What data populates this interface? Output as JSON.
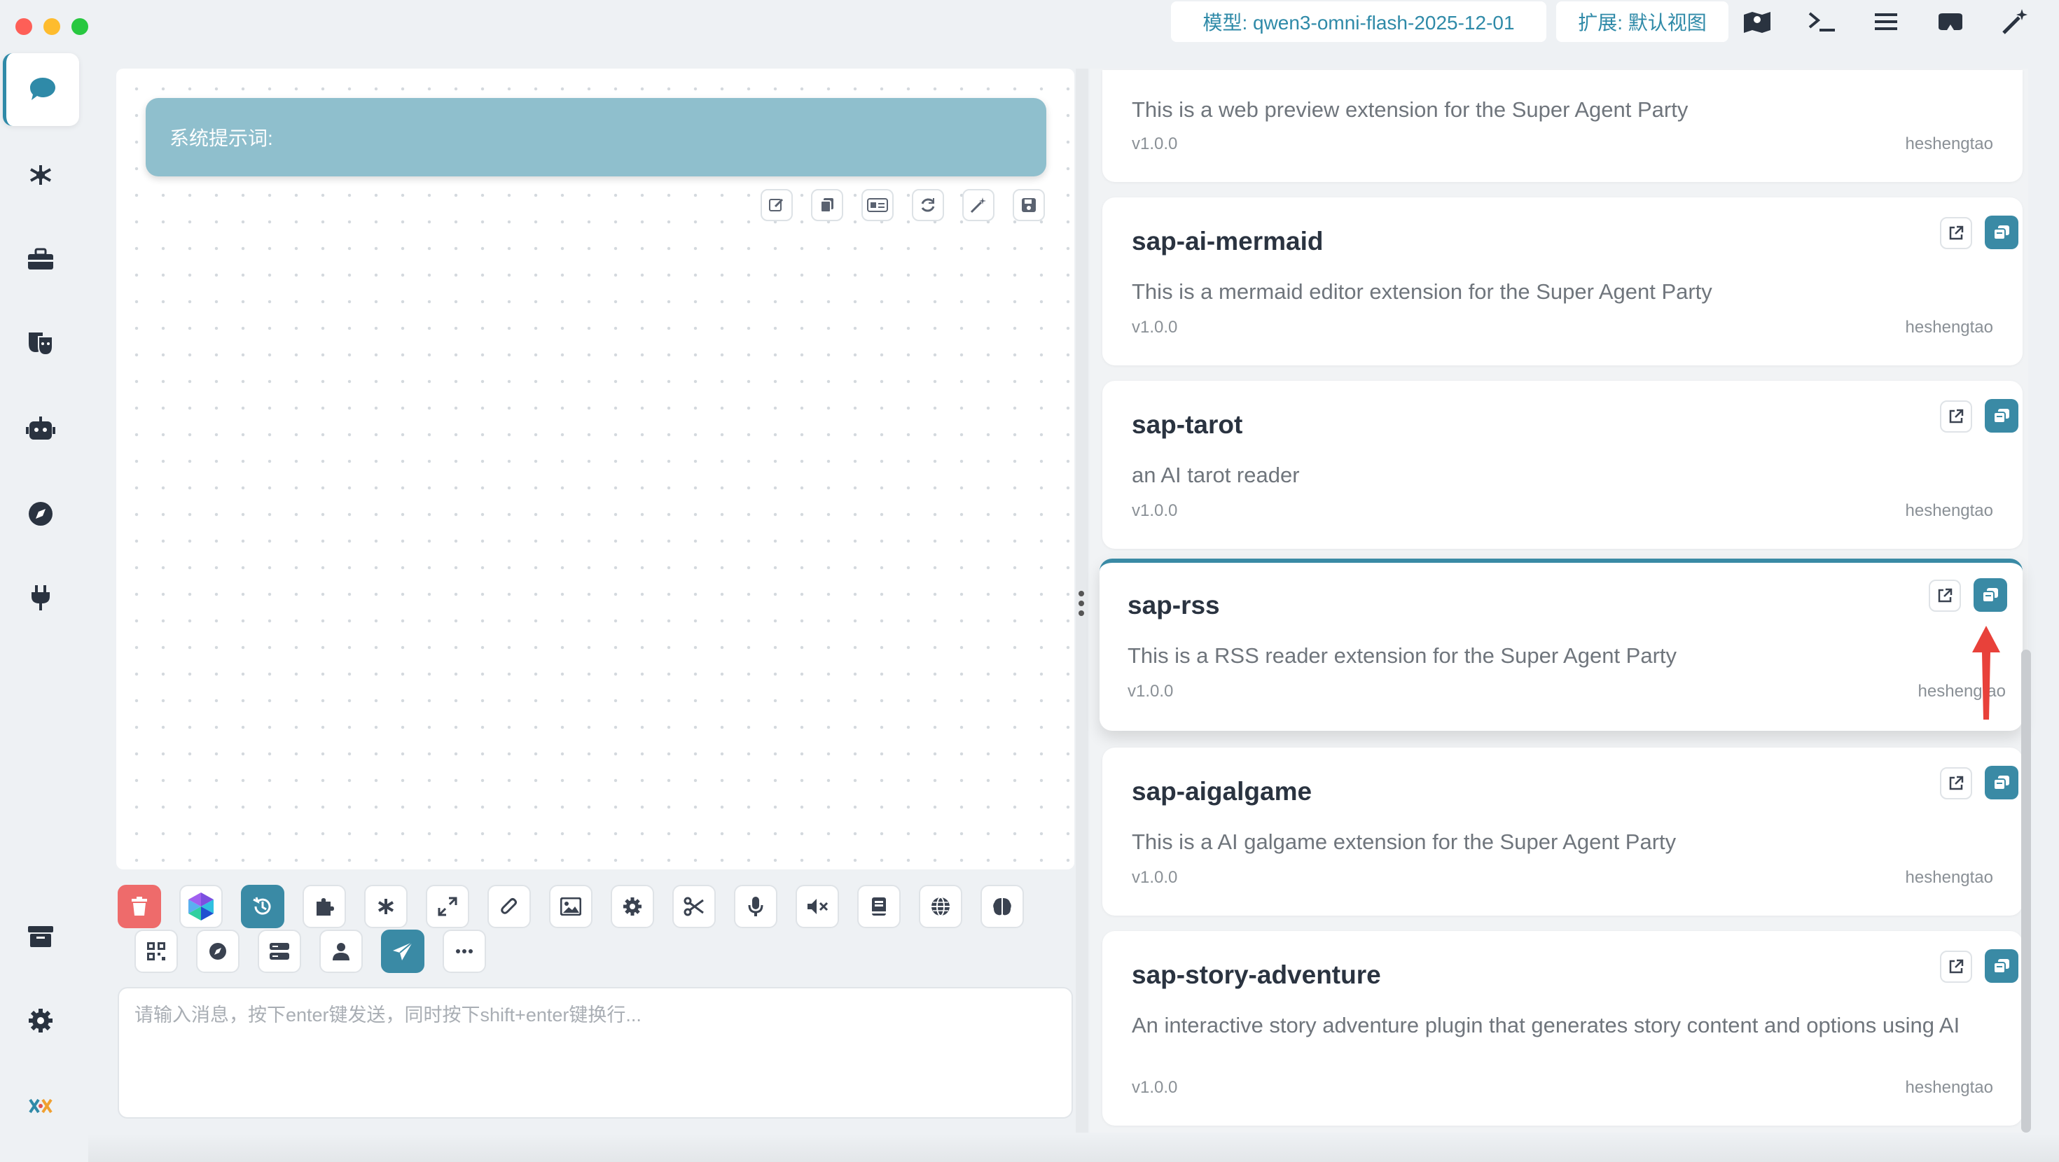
{
  "window": {
    "model_chip": "模型: qwen3-omni-flash-2025-12-01",
    "extension_chip": "扩展: 默认视图"
  },
  "top_icons": [
    "map-icon",
    "terminal-icon",
    "menu-icon",
    "vr-goggles-icon",
    "magic-wand-icon"
  ],
  "sidebar": {
    "items": [
      "chat-icon",
      "network-icon",
      "toolbox-icon",
      "theater-masks-icon",
      "robot-icon",
      "compass-icon",
      "plug-icon"
    ],
    "bottom": [
      "archive-icon",
      "settings-icon",
      "brand-logo-icon"
    ]
  },
  "chat": {
    "system_prompt_label": "系统提示词:",
    "prompt_tools": [
      "edit-icon",
      "copy-icon",
      "id-card-icon",
      "refresh-icon",
      "magic-icon",
      "save-icon"
    ],
    "input_placeholder": "请输入消息，按下enter键发送，同时按下shift+enter键换行..."
  },
  "toolbar": {
    "row1": [
      "trash-icon",
      "logo-cube-icon",
      "history-icon",
      "puzzle-icon",
      "asterisk-icon",
      "expand-icon",
      "paperclip-icon",
      "image-icon",
      "gear-icon",
      "scissors-icon",
      "microphone-icon",
      "mute-icon",
      "book-icon",
      "globe-icon",
      "brain-icon"
    ],
    "row2": [
      "qrcode-icon",
      "compass-icon",
      "server-icon",
      "user-icon",
      "send-icon",
      "more-icon"
    ]
  },
  "extensions": [
    {
      "name": "",
      "description": "This is a web preview extension for the Super Agent Party",
      "version": "v1.0.0",
      "author": "heshengtao"
    },
    {
      "name": "sap-ai-mermaid",
      "description": "This is a mermaid editor extension for the Super Agent Party",
      "version": "v1.0.0",
      "author": "heshengtao"
    },
    {
      "name": "sap-tarot",
      "description": "an AI tarot reader",
      "version": "v1.0.0",
      "author": "heshengtao"
    },
    {
      "name": "sap-rss",
      "description": "This is a RSS reader extension for the Super Agent Party",
      "version": "v1.0.0",
      "author": "heshengtao"
    },
    {
      "name": "sap-aigalgame",
      "description": "This is a AI galgame extension for the Super Agent Party",
      "version": "v1.0.0",
      "author": "heshengtao"
    },
    {
      "name": "sap-story-adventure",
      "description": "An interactive story adventure plugin that generates story content and options using AI",
      "version": "v1.0.0",
      "author": "heshengtao"
    }
  ],
  "colors": {
    "accent": "#3a8aa5",
    "system_prompt_bg": "#8fbfcd",
    "delete_red": "#ee6b6b",
    "annotation_arrow": "#e8413a"
  }
}
